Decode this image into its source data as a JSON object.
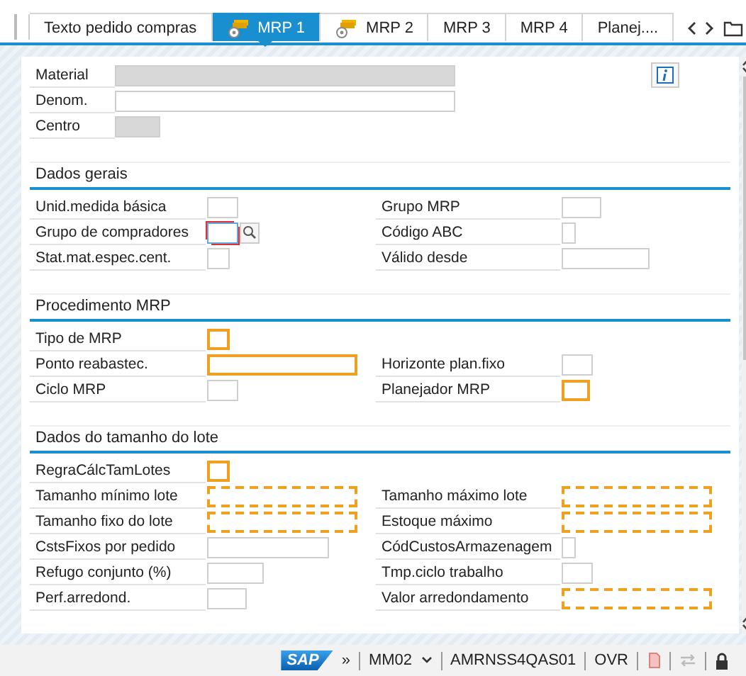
{
  "tabs": [
    {
      "label": "Texto pedido compras",
      "selected": false,
      "kind": "plain"
    },
    {
      "label": "MRP 1",
      "selected": true,
      "kind": "with-icon"
    },
    {
      "label": "MRP 2",
      "selected": false,
      "kind": "with-icon"
    },
    {
      "label": "MRP 3",
      "selected": false,
      "kind": "plain"
    },
    {
      "label": "MRP 4",
      "selected": false,
      "kind": "plain"
    },
    {
      "label": "Planej....",
      "selected": false,
      "kind": "plain"
    }
  ],
  "header": {
    "fields": [
      {
        "label": "Material",
        "disabled": true
      },
      {
        "label": "Denom.",
        "disabled": false
      },
      {
        "label": "Centro",
        "disabled": true
      }
    ]
  },
  "sections": [
    {
      "title": "Dados gerais",
      "rows": [
        {
          "left": {
            "label": "Unid.medida básica"
          },
          "right": {
            "label": "Grupo MRP"
          }
        },
        {
          "left": {
            "label": "Grupo de compradores",
            "focused": true,
            "search_help": true
          },
          "right": {
            "label": "Código ABC"
          }
        },
        {
          "left": {
            "label": "Stat.mat.espec.cent."
          },
          "right": {
            "label": "Válido desde"
          }
        }
      ]
    },
    {
      "title": "Procedimento MRP",
      "rows": [
        {
          "left": {
            "label": "Tipo de MRP",
            "outlined": true,
            "dashed": false
          }
        },
        {
          "left": {
            "label": "Ponto reabastec.",
            "outlined": true,
            "dashed": false
          },
          "right": {
            "label": "Horizonte plan.fixo"
          }
        },
        {
          "left": {
            "label": "Ciclo MRP"
          },
          "right": {
            "label": "Planejador MRP",
            "outlined": true,
            "dashed": false
          }
        }
      ]
    },
    {
      "title": "Dados do tamanho do lote",
      "rows": [
        {
          "left": {
            "label": "RegraCálcTamLotes",
            "outlined": true,
            "dashed": false
          }
        },
        {
          "left": {
            "label": "Tamanho mínimo lote",
            "outlined": true,
            "dashed": true
          },
          "right": {
            "label": "Tamanho máximo lote",
            "outlined": true,
            "dashed": true
          }
        },
        {
          "left": {
            "label": "Tamanho fixo do lote",
            "outlined": true,
            "dashed": true
          },
          "right": {
            "label": "Estoque máximo",
            "outlined": true,
            "dashed": true
          }
        },
        {
          "left": {
            "label": "CstsFixos por pedido"
          },
          "right": {
            "label": "CódCustosArmazenagem"
          }
        },
        {
          "left": {
            "label": "Refugo conjunto (%)"
          },
          "right": {
            "label": "Tmp.ciclo trabalho"
          }
        },
        {
          "left": {
            "label": "Perf.arredond."
          },
          "right": {
            "label": "Valor arredondamento",
            "outlined": true,
            "dashed": true
          }
        }
      ]
    }
  ],
  "status_bar": {
    "logo": "SAP",
    "expand": "»",
    "transaction": "MM02",
    "system": "AMRNSS4QAS01",
    "mode": "OVR"
  }
}
